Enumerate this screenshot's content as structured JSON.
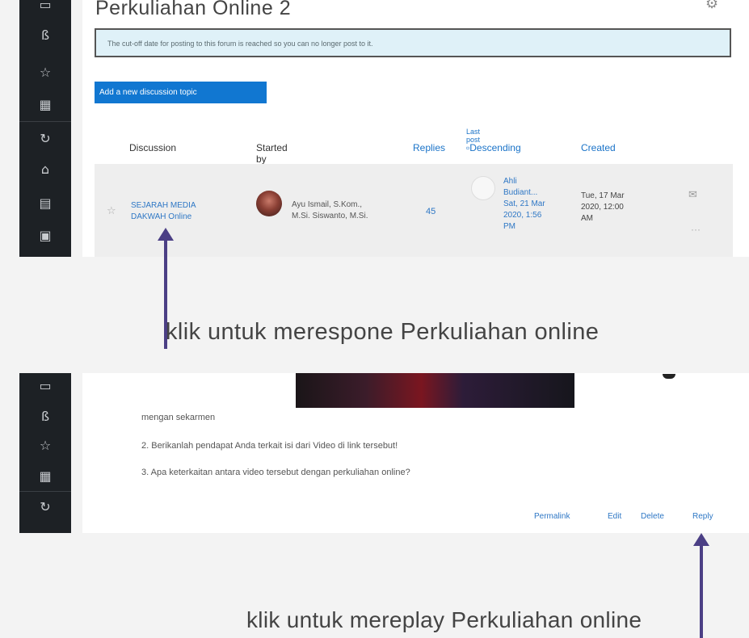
{
  "page_title": "Perkuliahan Online 2",
  "alert_text": "The cut-off date for posting to this forum is reached so you can no longer post to it.",
  "add_topic_label": "Add a new discussion topic",
  "table": {
    "headers": {
      "discussion": "Discussion",
      "started_by": "Started by",
      "replies": "Replies",
      "last_post": "Last post",
      "sort_img_alt": "Descending",
      "created": "Created"
    },
    "row": {
      "title_line1": "SEJARAH MEDIA",
      "title_line2": "DAKWAH Online",
      "starter_line1": "Ayu Ismail, S.Kom.,",
      "starter_line2": "M.Si. Siswanto, M.Si.",
      "replies": "45",
      "lastpost_line1": "Ahli",
      "lastpost_line2": "Budiant...",
      "lastpost_line3": "Sat, 21 Mar",
      "lastpost_line4": "2020, 1:56",
      "lastpost_line5": "PM",
      "created_line1": "Tue, 17 Mar",
      "created_line2": "2020, 12:00",
      "created_line3": "AM"
    }
  },
  "annotation_top": "klik untuk merespone Perkuliahan online",
  "post": {
    "line1": "mengan sekarmen",
    "line2": "2. Berikanlah pendapat Anda terkait isi dari Video di link tersebut!",
    "line3": "3. Apa keterkaitan antara video tersebut dengan perkuliahan online?"
  },
  "actions": {
    "permalink": "Permalink",
    "edit": "Edit",
    "delete": "Delete",
    "reply": "Reply"
  },
  "annotation_bottom": "klik untuk mereplay Perkuliahan online",
  "colors": {
    "accent": "#1177d1",
    "arrow": "#4b3f85",
    "sidebar": "#1d2125",
    "alert_bg": "#dff1f8"
  }
}
